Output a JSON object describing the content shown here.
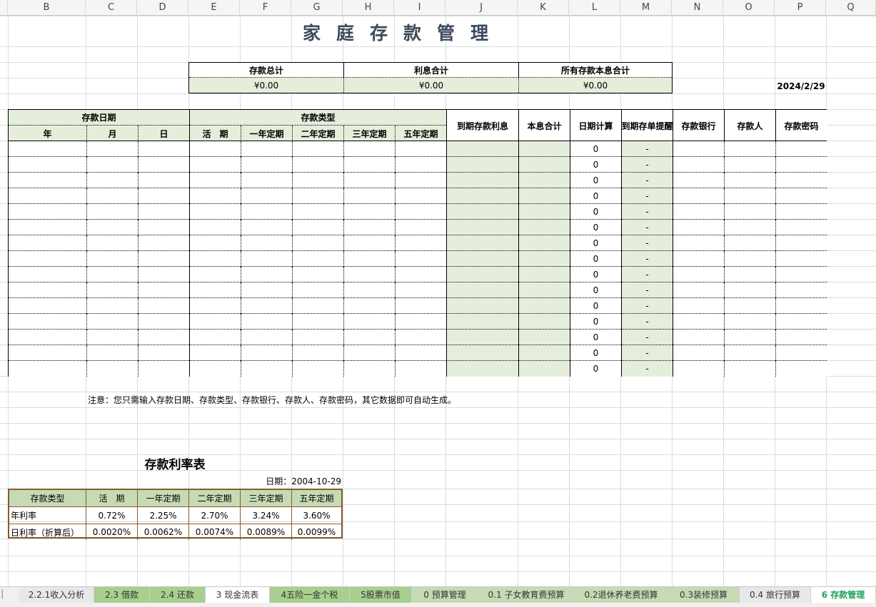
{
  "columns": [
    "B",
    "C",
    "D",
    "E",
    "F",
    "G",
    "H",
    "I",
    "J",
    "K",
    "L",
    "M",
    "N",
    "O",
    "P",
    "Q"
  ],
  "title": "家庭存款管理",
  "summary": {
    "headers": [
      "存款总计",
      "利息合计",
      "所有存款本息合计"
    ],
    "values": [
      "¥0.00",
      "¥0.00",
      "¥0.00"
    ]
  },
  "current_date": "2024/2/29",
  "main_table": {
    "group_date": "存款日期",
    "group_type": "存款类型",
    "date_cols": [
      "年",
      "月",
      "日"
    ],
    "type_cols": [
      "活　期",
      "一年定期",
      "二年定期",
      "三年定期",
      "五年定期"
    ],
    "other_cols": [
      "到期存款利息",
      "本息合计",
      "日期计算",
      "到期存单提醒",
      "存款银行",
      "存款人",
      "存款密码"
    ],
    "row_count": 15,
    "date_calc_value": "0",
    "reminder_value": "-"
  },
  "note": "注意：您只需输入存款日期、存款类型、存款银行、存款人、存款密码，其它数据即可自动生成。",
  "rate_table": {
    "title": "存款利率表",
    "date_label": "日期：2004-10-29",
    "header": [
      "存款类型",
      "活　期",
      "一年定期",
      "二年定期",
      "三年定期",
      "五年定期"
    ],
    "rows": [
      [
        "年利率",
        "0.72%",
        "2.25%",
        "2.70%",
        "3.24%",
        "3.60%"
      ],
      [
        "日利率（折算后）",
        "0.0020%",
        "0.0062%",
        "0.0074%",
        "0.0089%",
        "0.0099%"
      ]
    ]
  },
  "tabs": [
    {
      "label": "2.2.1收入分析",
      "active": false,
      "color": "#e8e8e8"
    },
    {
      "label": "2.3 借款",
      "active": false,
      "color": "#a9cf8e"
    },
    {
      "label": "2.4 还款",
      "active": false,
      "color": "#a9cf8e"
    },
    {
      "label": "3 现金流表",
      "active": false,
      "color": "#ffffff"
    },
    {
      "label": "4五险一金个税",
      "active": false,
      "color": "#a9cf8e"
    },
    {
      "label": "5股票市值",
      "active": false,
      "color": "#a9cf8e"
    },
    {
      "label": "0 预算管理",
      "active": false,
      "color": "#c6dbb4"
    },
    {
      "label": "0.1 子女教育费预算",
      "active": false,
      "color": "#c6dbb4"
    },
    {
      "label": "0.2退休养老费预算",
      "active": false,
      "color": "#c6dbb4"
    },
    {
      "label": "0.3装修预算",
      "active": false,
      "color": "#c6dbb4"
    },
    {
      "label": "0.4 旅行预算",
      "active": false,
      "color": "#e8e8e8"
    },
    {
      "label": "6 存款管理",
      "active": true,
      "color": "#ffffff"
    }
  ],
  "colors": {
    "accent_green": "#e4eedb",
    "active_tab_text": "#1fa35b",
    "rate_border": "#8b5a2b"
  }
}
